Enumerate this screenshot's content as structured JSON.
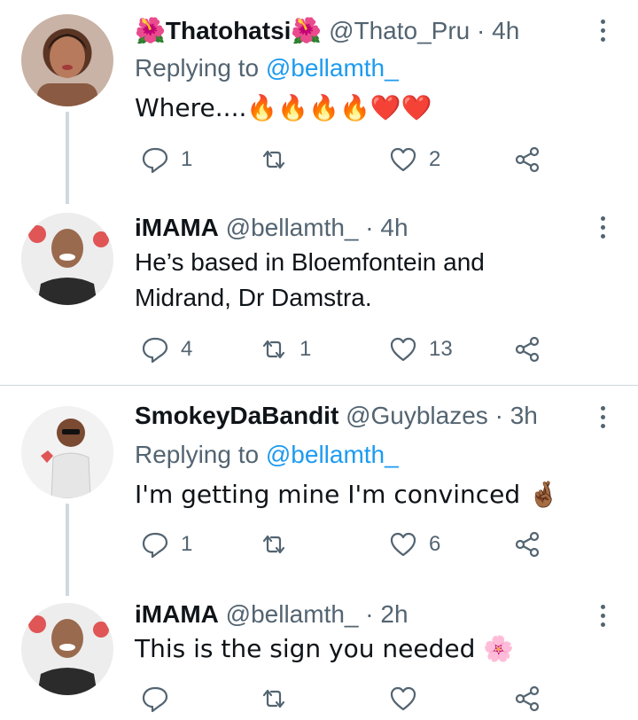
{
  "tweets": [
    {
      "name": "🌺Thatohatsi🌺",
      "handle": "@Thato_Pru",
      "dot": "·",
      "time": "4h",
      "replying_label": "Replying to ",
      "replying_to": "@bellamth_",
      "text": "Where....🔥🔥🔥🔥❤️❤️",
      "replies": "1",
      "retweets": "",
      "likes": "2"
    },
    {
      "name": "iMAMA",
      "handle": "@bellamth_",
      "dot": "·",
      "time": "4h",
      "text_line1": "He’s based in Bloemfontein and",
      "text_line2": "Midrand, Dr Damstra.",
      "replies": "4",
      "retweets": "1",
      "likes": "13"
    },
    {
      "name": "SmokeyDaBandit",
      "handle": "@Guyblazes",
      "dot": "·",
      "time": "3h",
      "replying_label": "Replying to ",
      "replying_to": "@bellamth_",
      "text": "I'm getting mine I'm convinced 🤞🏾",
      "replies": "1",
      "retweets": "",
      "likes": "6"
    },
    {
      "name": "iMAMA",
      "handle": "@bellamth_",
      "dot": "·",
      "time": "2h",
      "text": "This is the sign you needed 🌸",
      "replies": "",
      "retweets": "",
      "likes": ""
    }
  ],
  "colors": {
    "text": "#0f1419",
    "secondary": "#536471",
    "link": "#1d9bf0",
    "divider": "#cfd9de"
  },
  "icons": [
    "reply-icon",
    "retweet-icon",
    "like-icon",
    "share-icon",
    "more-options-icon"
  ]
}
